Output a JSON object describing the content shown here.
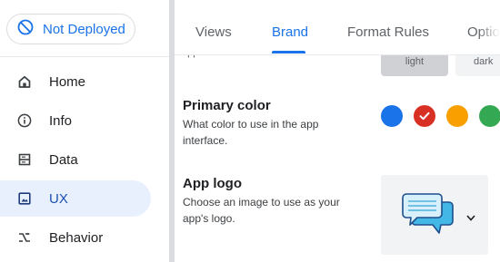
{
  "deploy_status": {
    "label": "Not Deployed",
    "icon": "not-deployed-icon",
    "color": "#1a73e8"
  },
  "nav": {
    "items": [
      {
        "label": "Home",
        "icon": "home-icon",
        "active": false
      },
      {
        "label": "Info",
        "icon": "info-icon",
        "active": false
      },
      {
        "label": "Data",
        "icon": "data-icon",
        "active": false
      },
      {
        "label": "UX",
        "icon": "ux-image-icon",
        "active": true
      },
      {
        "label": "Behavior",
        "icon": "behavior-icon",
        "active": false
      }
    ]
  },
  "tabs": [
    {
      "label": "Views",
      "active": false
    },
    {
      "label": "Brand",
      "active": true
    },
    {
      "label": "Format Rules",
      "active": false
    },
    {
      "label": "Optio",
      "active": false
    }
  ],
  "theme_row": {
    "cut_text": "app.",
    "options": [
      {
        "label": "light",
        "selected": true
      },
      {
        "label": "dark",
        "selected": false
      }
    ]
  },
  "primary_color": {
    "title": "Primary color",
    "description": "What color to use in the app interface.",
    "options": [
      {
        "color": "#1a73e8",
        "selected": false
      },
      {
        "color": "#d93025",
        "selected": true
      },
      {
        "color": "#f9a000",
        "selected": false
      },
      {
        "color": "#34a853",
        "selected": false
      }
    ]
  },
  "app_logo": {
    "title": "App logo",
    "description": "Choose an image to use as your app's logo.",
    "image": "chat-bubbles-icon",
    "dropdown_icon": "caret-down-icon"
  },
  "colors": {
    "accent": "#1a73e8",
    "active_nav_bg": "#e8f0fe"
  }
}
